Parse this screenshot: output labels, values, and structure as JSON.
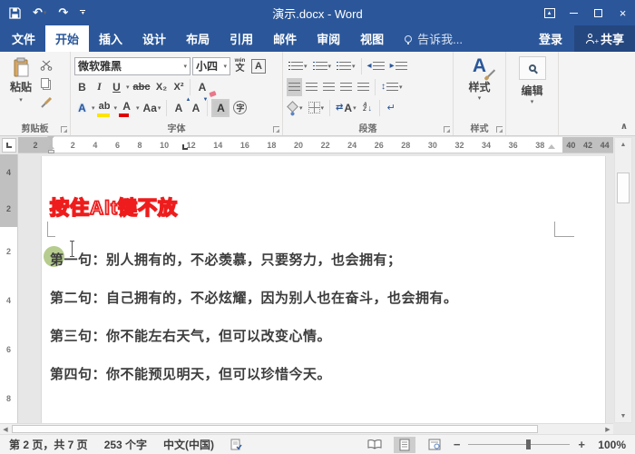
{
  "colors": {
    "accent_blue": "#2b579a",
    "annotation_red": "#ee1c1c",
    "click_indicator_green": "#b5cc8e"
  },
  "titlebar": {
    "title": "演示.docx - Word"
  },
  "tab_bar": {
    "tabs": [
      {
        "label": "文件"
      },
      {
        "label": "开始",
        "active": true
      },
      {
        "label": "插入"
      },
      {
        "label": "设计"
      },
      {
        "label": "布局"
      },
      {
        "label": "引用"
      },
      {
        "label": "邮件"
      },
      {
        "label": "审阅"
      },
      {
        "label": "视图"
      }
    ],
    "tell_me": "告诉我...",
    "sign_in": "登录",
    "share": "共享"
  },
  "ribbon": {
    "clipboard": {
      "paste": "粘贴",
      "label": "剪贴板"
    },
    "font": {
      "name": "微软雅黑",
      "size": "小四",
      "bold": "B",
      "italic": "I",
      "underline": "U",
      "strikethrough": "abc",
      "subscript": "X₂",
      "superscript": "X²",
      "clear_format": "A",
      "text_effects": "A",
      "highlight": "ab",
      "font_color": "A",
      "change_case": "Aa",
      "grow_font": "A",
      "shrink_font": "A",
      "char_shading": "A",
      "enclose": "字",
      "pinyin_top": "wén",
      "pinyin_bottom": "文",
      "char_border": "A",
      "label": "字体"
    },
    "paragraph": {
      "sort_a": "A",
      "sort_z": "Z",
      "asian_layout": "A",
      "label": "段落"
    },
    "styles": {
      "icon_letter": "A",
      "button": "样式",
      "label": "样式"
    },
    "editing": {
      "button": "编辑"
    }
  },
  "ruler": {
    "left_margin_numbers": [
      "2"
    ],
    "numbers": [
      "2",
      "4",
      "6",
      "8",
      "10",
      "12",
      "14",
      "16",
      "18",
      "20",
      "22",
      "24",
      "26",
      "28",
      "30",
      "32",
      "34",
      "36",
      "38"
    ],
    "right_margin_numbers": [
      "40",
      "42",
      "44"
    ],
    "v_margin_numbers": [
      "4",
      "2"
    ],
    "v_numbers": [
      "2",
      "4",
      "6",
      "8"
    ]
  },
  "document": {
    "annotation": "按住Alt键不放",
    "lines": [
      "第一句：别人拥有的，不必羡慕，只要努力，也会拥有；",
      "第二句：自己拥有的，不必炫耀，因为别人也在奋斗，也会拥有。",
      "第三句：你不能左右天气，但可以改变心情。",
      "第四句：你不能预见明天，但可以珍惜今天。"
    ]
  },
  "status_bar": {
    "page_info": "第 2 页，共 7 页",
    "word_count": "253 个字",
    "language": "中文(中国)",
    "zoom_out": "−",
    "zoom_in": "+",
    "zoom_level": "100%"
  }
}
